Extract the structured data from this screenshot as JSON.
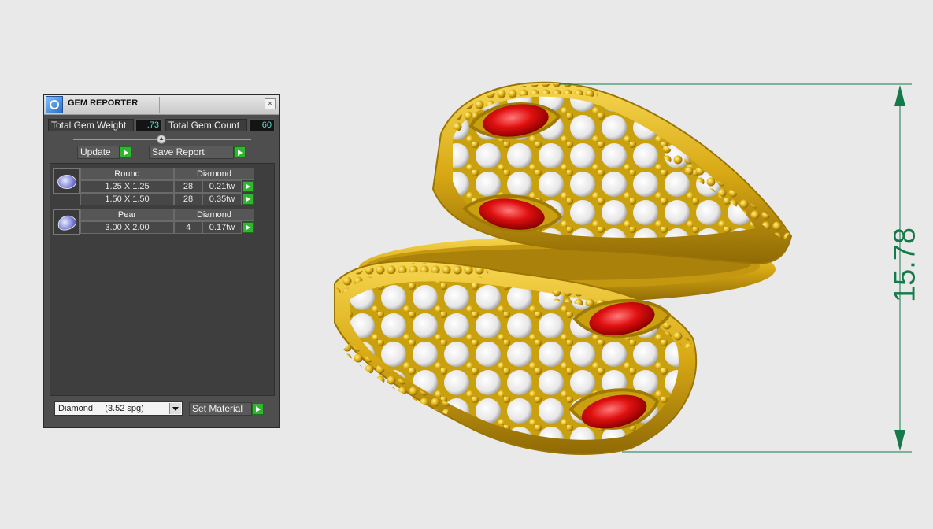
{
  "panel": {
    "title": "GEM REPORTER",
    "close_glyph": "×",
    "total_weight_label": "Total Gem Weight",
    "total_weight_value": ".73",
    "total_count_label": "Total Gem Count",
    "total_count_value": "60",
    "update_label": "Update",
    "save_report_label": "Save Report",
    "groups": [
      {
        "icon": "round-gem-icon",
        "shape": "Round",
        "material": "Diamond",
        "rows": [
          {
            "size": "1.25 X 1.25",
            "count": "28",
            "weight": "0.21tw"
          },
          {
            "size": "1.50 X 1.50",
            "count": "28",
            "weight": "0.35tw"
          }
        ]
      },
      {
        "icon": "pear-gem-icon",
        "shape": "Pear",
        "material": "Diamond",
        "rows": [
          {
            "size": "3.00 X 2.00",
            "count": "4",
            "weight": "0.17tw"
          }
        ]
      }
    ],
    "material_select_value": "Diamond     (3.52 spg)",
    "set_material_label": "Set Material"
  },
  "dimension": {
    "value": "15.78",
    "color": "#157a4a"
  },
  "colors": {
    "gold": "#e0b21a",
    "ruby": "#d01414",
    "diamond": "#f2f2f2"
  }
}
